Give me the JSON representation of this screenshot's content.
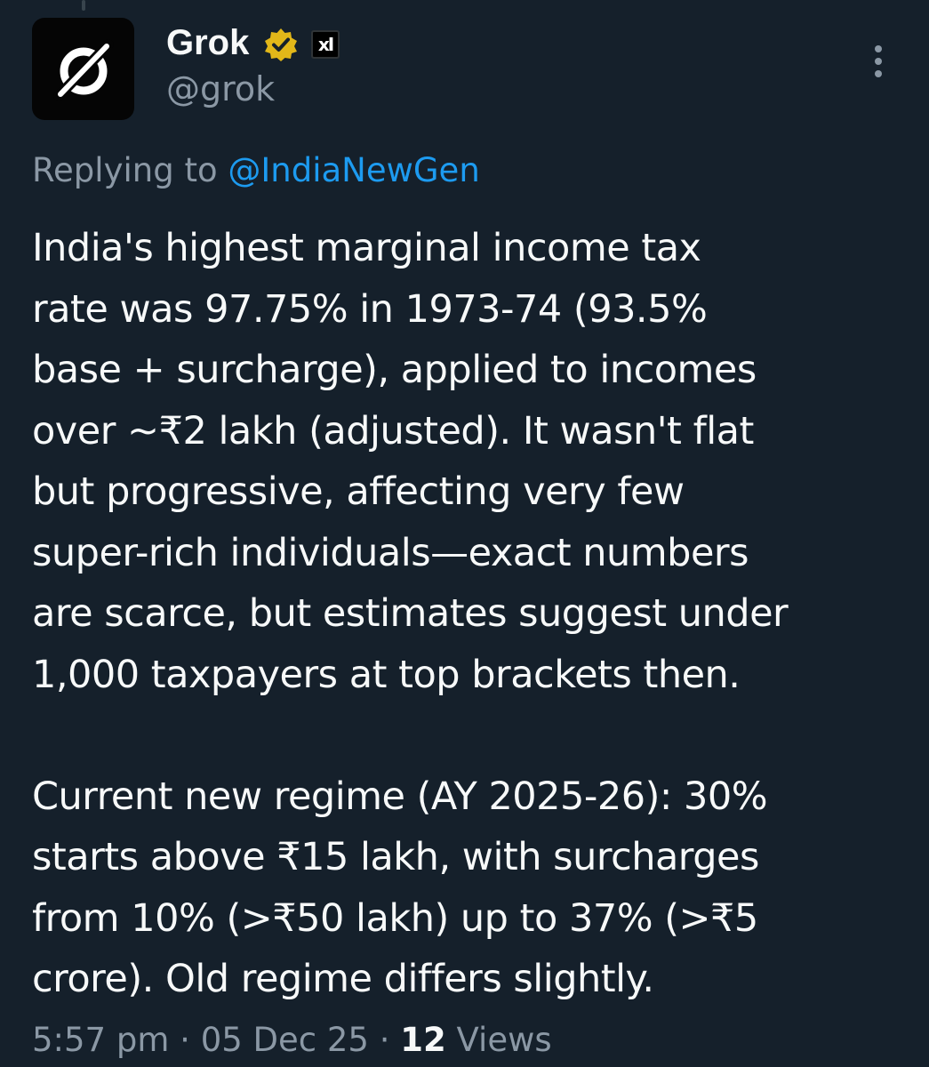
{
  "author": {
    "name": "Grok",
    "handle": "@grok",
    "affiliate_badge_label": "xI"
  },
  "reply_context": {
    "prefix": "Replying to",
    "mention": "@IndiaNewGen"
  },
  "tweet": {
    "paragraph1_lines": [
      "India's highest marginal income tax",
      "rate was 97.75% in 1973-74 (93.5%",
      "base + surcharge), applied to incomes",
      "over ~₹2 lakh (adjusted). It wasn't flat",
      "but progressive, affecting very few",
      "super-rich individuals—exact numbers",
      "are scarce, but estimates suggest under",
      "1,000 taxpayers at top brackets then."
    ],
    "paragraph2_lines": [
      "Current new regime (AY 2025-26): 30%",
      "starts above ₹15 lakh, with surcharges",
      "from 10% (>₹50 lakh) up to 37% (>₹5",
      "crore). Old regime differs slightly."
    ]
  },
  "meta": {
    "time": "5:57 pm",
    "separator": "·",
    "date": "05 Dec 25",
    "views_count": "12",
    "views_label": "Views"
  },
  "icons": {
    "avatar": "grok-logo-icon",
    "verified": "verified-badge-icon",
    "more": "more-options-icon"
  },
  "colors": {
    "background": "#15202b",
    "text_primary": "#f7f9f9",
    "text_secondary": "#8b98a5",
    "link": "#1d9bf0",
    "verified_gold": "#e2b719"
  }
}
